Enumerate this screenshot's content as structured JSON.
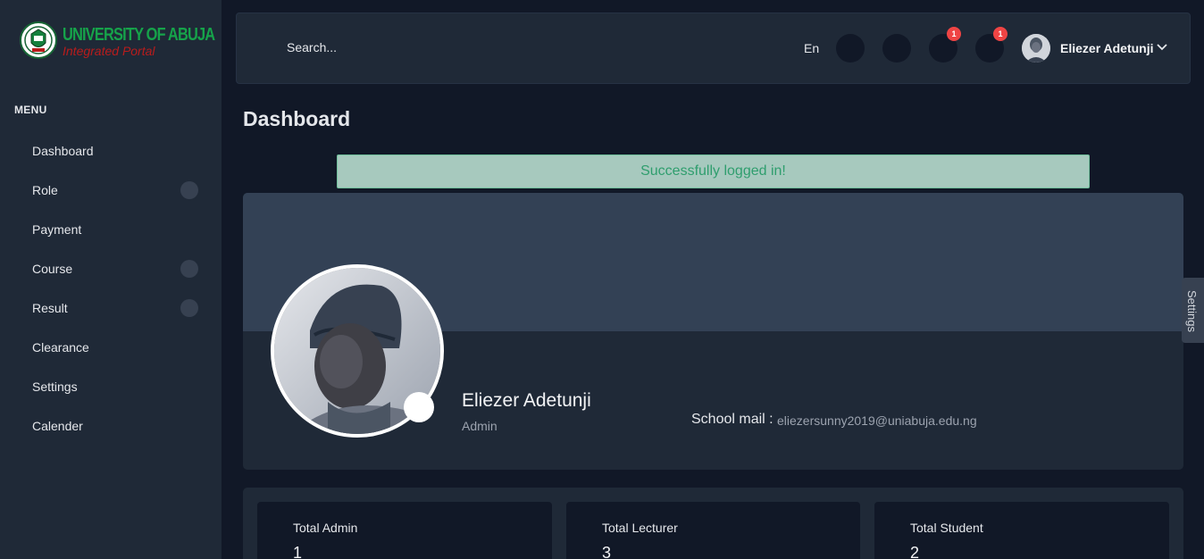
{
  "brand": {
    "title": "UNIVERSITY OF ABUJA",
    "subtitle": "Integrated Portal"
  },
  "sidebar": {
    "menu_heading": "MENU",
    "items": [
      {
        "label": "Dashboard",
        "has_toggle": false
      },
      {
        "label": "Role",
        "has_toggle": true
      },
      {
        "label": "Payment",
        "has_toggle": false
      },
      {
        "label": "Course",
        "has_toggle": true
      },
      {
        "label": "Result",
        "has_toggle": true
      },
      {
        "label": "Clearance",
        "has_toggle": false
      },
      {
        "label": "Settings",
        "has_toggle": false
      },
      {
        "label": "Calender",
        "has_toggle": false
      }
    ]
  },
  "topbar": {
    "search_placeholder": "Search...",
    "language": "En",
    "notifications": [
      {
        "icon": "fullscreen-icon",
        "badge": ""
      },
      {
        "icon": "apps-grid-icon",
        "badge": ""
      },
      {
        "icon": "bell-icon",
        "badge": "1"
      },
      {
        "icon": "message-icon",
        "badge": "1"
      }
    ],
    "user_name": "Eliezer Adetunji"
  },
  "main": {
    "page_title": "Dashboard",
    "alert": "Successfully logged in!",
    "profile": {
      "name": "Eliezer Adetunji",
      "role": "Admin",
      "mail_label": "School mail :",
      "mail_value": "eliezersunny2019@uniabuja.edu.ng"
    },
    "stats": [
      {
        "label": "Total Admin",
        "value": "1"
      },
      {
        "label": "Total Lecturer",
        "value": "3"
      },
      {
        "label": "Total Student",
        "value": "2"
      }
    ]
  },
  "settings_tab": "Settings",
  "colors": {
    "background": "#111827",
    "panel": "#1f2937",
    "cover": "#334155",
    "brand_green": "#16a34a",
    "brand_red": "#b91c1c",
    "alert_bg": "#a7c9be",
    "alert_text": "#2f9e6e",
    "badge": "#ef4444"
  }
}
